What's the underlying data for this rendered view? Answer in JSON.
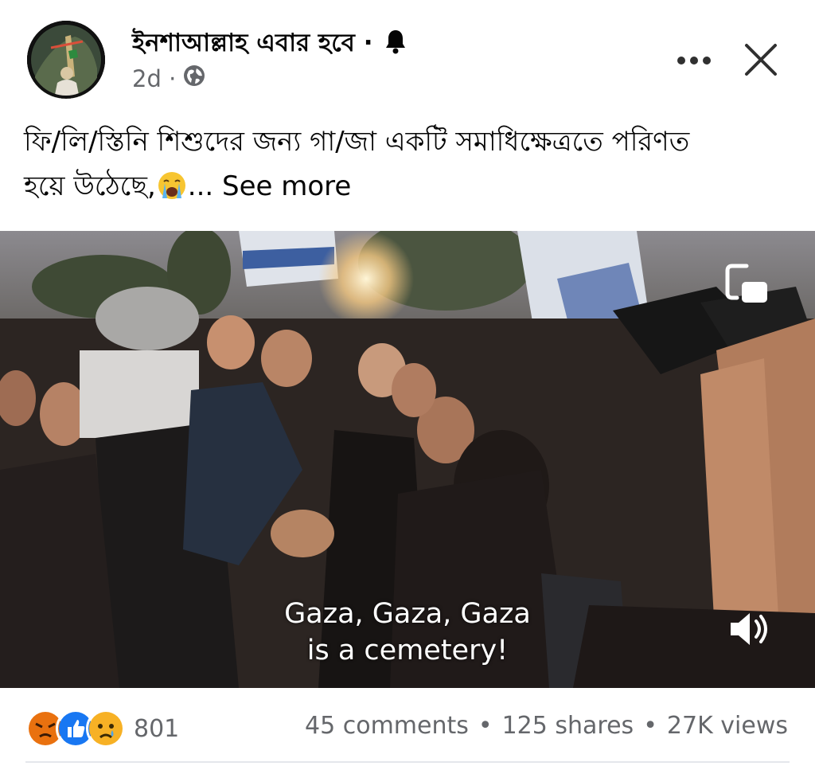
{
  "post": {
    "page_name": "ইনশাআল্লাহ এবার হবে ·",
    "time": "2d ·",
    "caption_line1": "ফি/লি/স্তিনি শিশুদের জন্য গা/জা একটি সমাধিক্ষেত্রতে পরিণত",
    "caption_line2": "হয়ে উঠেছে,",
    "ellipsis": "...",
    "see_more": "See more"
  },
  "video": {
    "subtitle_line1": "Gaza, Gaza, Gaza",
    "subtitle_line2": "is a cemetery!"
  },
  "footer": {
    "reaction_count": "801",
    "comments": "45 comments",
    "shares": "125 shares",
    "views": "27K views",
    "separator": "•"
  },
  "icons": {
    "bell": "bell-icon",
    "globe": "globe-icon",
    "more": "more-horizontal-icon",
    "close": "close-icon",
    "pip": "picture-in-picture-icon",
    "volume": "volume-icon",
    "reactions": [
      "angry-reaction-icon",
      "like-reaction-icon",
      "sad-reaction-icon"
    ]
  },
  "colors": {
    "secondary_text": "#65676b",
    "like_blue": "#1877f2",
    "angry_orange": "#e9710f",
    "sad_yellow": "#f7b125"
  }
}
